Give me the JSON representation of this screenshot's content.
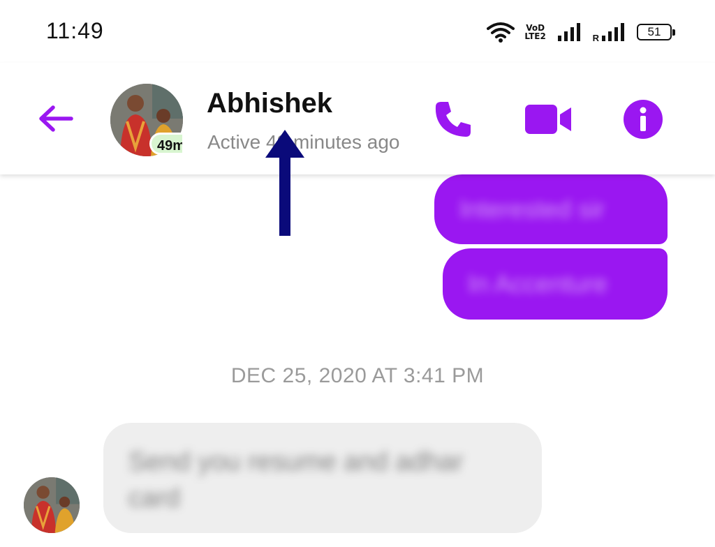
{
  "status_bar": {
    "time": "11:49",
    "network_label_top": "VoD",
    "network_label_bottom": "LTE2",
    "roaming_label": "R",
    "battery_level": "51"
  },
  "header": {
    "contact_name": "Abhishek",
    "contact_status": "Active 49 minutes ago",
    "active_badge": "49m",
    "accent_color": "#9a17f1"
  },
  "messages": {
    "outgoing": [
      {
        "text": "Interested sir"
      },
      {
        "text": "In Accenture"
      }
    ],
    "timestamp": "DEC 25, 2020 AT 3:41 PM",
    "incoming": [
      {
        "text": "Send you resume and adhar card"
      }
    ]
  },
  "icons": {
    "back": "back-arrow-icon",
    "call": "phone-icon",
    "video": "video-camera-icon",
    "info": "info-icon"
  }
}
